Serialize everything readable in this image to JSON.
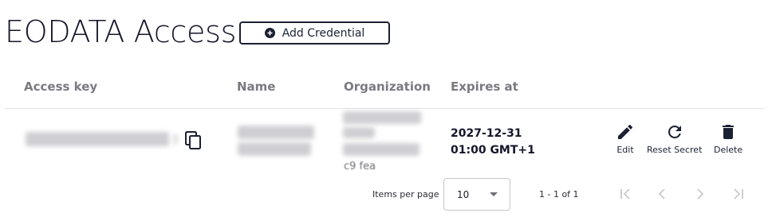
{
  "page": {
    "title": "EODATA Access",
    "add_button_label": "Add Credential"
  },
  "table": {
    "columns": [
      "Access key",
      "Name",
      "Organization",
      "Expires at"
    ],
    "rows": [
      {
        "expires_date": "2027-12-31",
        "expires_time": "01:00 GMT+1",
        "organization_trailing": "c9 fea",
        "actions": [
          "Edit",
          "Reset Secret",
          "Delete"
        ]
      }
    ]
  },
  "pagination": {
    "items_per_page_label": "Items per page",
    "items_per_page_value": "10",
    "range_label": "1 - 1 of 1"
  },
  "icons": {
    "add": "plus-circle-icon",
    "copy": "copy-icon",
    "edit": "pencil-icon",
    "reset": "refresh-icon",
    "delete": "trash-icon",
    "first": "first-page-icon",
    "prev": "chevron-left-icon",
    "next": "chevron-right-icon",
    "last": "last-page-icon"
  },
  "colors": {
    "primary": "#1c2033",
    "header_text": "#7a7a80",
    "divider": "#e3e3e7",
    "disabled": "#c9c9ce"
  }
}
